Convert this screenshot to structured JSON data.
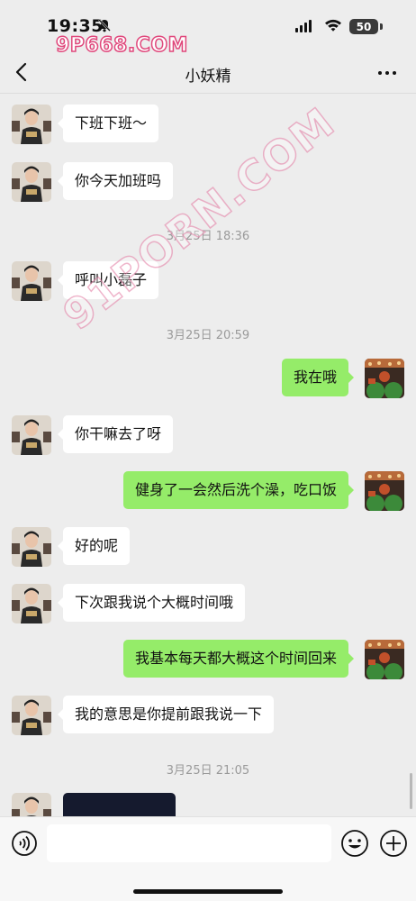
{
  "status_bar": {
    "time": "19:35",
    "battery": "50"
  },
  "watermark": {
    "small": "9P668.COM",
    "big": "91PORN.COM"
  },
  "header": {
    "title": "小妖精"
  },
  "messages": [
    {
      "side": "left",
      "text": "下班下班～"
    },
    {
      "side": "left",
      "text": "你今天加班吗"
    },
    {
      "timestamp": "3月25日 18:36"
    },
    {
      "side": "left",
      "text": "呼叫小磊子"
    },
    {
      "timestamp": "3月25日 20:59"
    },
    {
      "side": "right",
      "text": "我在哦"
    },
    {
      "side": "left",
      "text": "你干嘛去了呀"
    },
    {
      "side": "right",
      "text": "健身了一会然后洗个澡，吃口饭"
    },
    {
      "side": "left",
      "text": "好的呢"
    },
    {
      "side": "left",
      "text": "下次跟我说个大概时间哦"
    },
    {
      "side": "right",
      "text": "我基本每天都大概这个时间回来"
    },
    {
      "side": "left",
      "text": "我的意思是你提前跟我说一下"
    },
    {
      "timestamp": "3月25日 21:05"
    },
    {
      "side": "left",
      "type": "image"
    }
  ],
  "input": {
    "value": "",
    "placeholder": ""
  },
  "colors": {
    "sent_bubble": "#95ec69",
    "received_bubble": "#ffffff",
    "background": "#ededed"
  },
  "icons": [
    "bell-slash-icon",
    "signal-icon",
    "wifi-icon",
    "battery-icon",
    "back-arrow-icon",
    "more-icon",
    "voice-icon",
    "emoji-icon",
    "plus-icon"
  ]
}
